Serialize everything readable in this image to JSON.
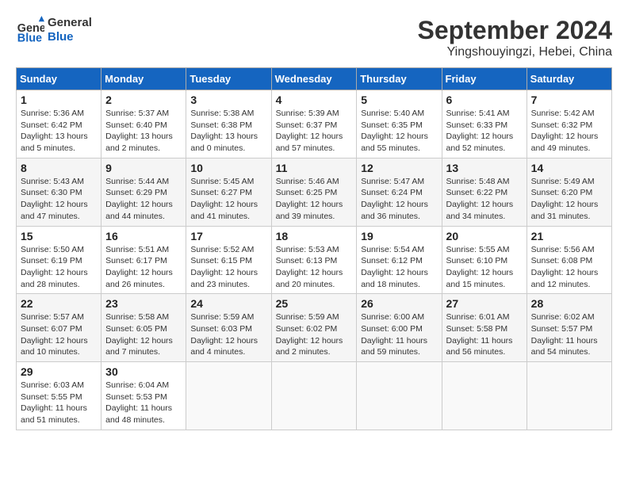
{
  "header": {
    "logo_line1": "General",
    "logo_line2": "Blue",
    "month": "September 2024",
    "location": "Yingshouyingzi, Hebei, China"
  },
  "days_of_week": [
    "Sunday",
    "Monday",
    "Tuesday",
    "Wednesday",
    "Thursday",
    "Friday",
    "Saturday"
  ],
  "weeks": [
    [
      {
        "day": "1",
        "sunrise": "5:36 AM",
        "sunset": "6:42 PM",
        "daylight": "13 hours and 5 minutes."
      },
      {
        "day": "2",
        "sunrise": "5:37 AM",
        "sunset": "6:40 PM",
        "daylight": "13 hours and 2 minutes."
      },
      {
        "day": "3",
        "sunrise": "5:38 AM",
        "sunset": "6:38 PM",
        "daylight": "13 hours and 0 minutes."
      },
      {
        "day": "4",
        "sunrise": "5:39 AM",
        "sunset": "6:37 PM",
        "daylight": "12 hours and 57 minutes."
      },
      {
        "day": "5",
        "sunrise": "5:40 AM",
        "sunset": "6:35 PM",
        "daylight": "12 hours and 55 minutes."
      },
      {
        "day": "6",
        "sunrise": "5:41 AM",
        "sunset": "6:33 PM",
        "daylight": "12 hours and 52 minutes."
      },
      {
        "day": "7",
        "sunrise": "5:42 AM",
        "sunset": "6:32 PM",
        "daylight": "12 hours and 49 minutes."
      }
    ],
    [
      {
        "day": "8",
        "sunrise": "5:43 AM",
        "sunset": "6:30 PM",
        "daylight": "12 hours and 47 minutes."
      },
      {
        "day": "9",
        "sunrise": "5:44 AM",
        "sunset": "6:29 PM",
        "daylight": "12 hours and 44 minutes."
      },
      {
        "day": "10",
        "sunrise": "5:45 AM",
        "sunset": "6:27 PM",
        "daylight": "12 hours and 41 minutes."
      },
      {
        "day": "11",
        "sunrise": "5:46 AM",
        "sunset": "6:25 PM",
        "daylight": "12 hours and 39 minutes."
      },
      {
        "day": "12",
        "sunrise": "5:47 AM",
        "sunset": "6:24 PM",
        "daylight": "12 hours and 36 minutes."
      },
      {
        "day": "13",
        "sunrise": "5:48 AM",
        "sunset": "6:22 PM",
        "daylight": "12 hours and 34 minutes."
      },
      {
        "day": "14",
        "sunrise": "5:49 AM",
        "sunset": "6:20 PM",
        "daylight": "12 hours and 31 minutes."
      }
    ],
    [
      {
        "day": "15",
        "sunrise": "5:50 AM",
        "sunset": "6:19 PM",
        "daylight": "12 hours and 28 minutes."
      },
      {
        "day": "16",
        "sunrise": "5:51 AM",
        "sunset": "6:17 PM",
        "daylight": "12 hours and 26 minutes."
      },
      {
        "day": "17",
        "sunrise": "5:52 AM",
        "sunset": "6:15 PM",
        "daylight": "12 hours and 23 minutes."
      },
      {
        "day": "18",
        "sunrise": "5:53 AM",
        "sunset": "6:13 PM",
        "daylight": "12 hours and 20 minutes."
      },
      {
        "day": "19",
        "sunrise": "5:54 AM",
        "sunset": "6:12 PM",
        "daylight": "12 hours and 18 minutes."
      },
      {
        "day": "20",
        "sunrise": "5:55 AM",
        "sunset": "6:10 PM",
        "daylight": "12 hours and 15 minutes."
      },
      {
        "day": "21",
        "sunrise": "5:56 AM",
        "sunset": "6:08 PM",
        "daylight": "12 hours and 12 minutes."
      }
    ],
    [
      {
        "day": "22",
        "sunrise": "5:57 AM",
        "sunset": "6:07 PM",
        "daylight": "12 hours and 10 minutes."
      },
      {
        "day": "23",
        "sunrise": "5:58 AM",
        "sunset": "6:05 PM",
        "daylight": "12 hours and 7 minutes."
      },
      {
        "day": "24",
        "sunrise": "5:59 AM",
        "sunset": "6:03 PM",
        "daylight": "12 hours and 4 minutes."
      },
      {
        "day": "25",
        "sunrise": "5:59 AM",
        "sunset": "6:02 PM",
        "daylight": "12 hours and 2 minutes."
      },
      {
        "day": "26",
        "sunrise": "6:00 AM",
        "sunset": "6:00 PM",
        "daylight": "11 hours and 59 minutes."
      },
      {
        "day": "27",
        "sunrise": "6:01 AM",
        "sunset": "5:58 PM",
        "daylight": "11 hours and 56 minutes."
      },
      {
        "day": "28",
        "sunrise": "6:02 AM",
        "sunset": "5:57 PM",
        "daylight": "11 hours and 54 minutes."
      }
    ],
    [
      {
        "day": "29",
        "sunrise": "6:03 AM",
        "sunset": "5:55 PM",
        "daylight": "11 hours and 51 minutes."
      },
      {
        "day": "30",
        "sunrise": "6:04 AM",
        "sunset": "5:53 PM",
        "daylight": "11 hours and 48 minutes."
      },
      null,
      null,
      null,
      null,
      null
    ]
  ],
  "labels": {
    "sunrise": "Sunrise:",
    "sunset": "Sunset:",
    "daylight": "Daylight hours"
  }
}
